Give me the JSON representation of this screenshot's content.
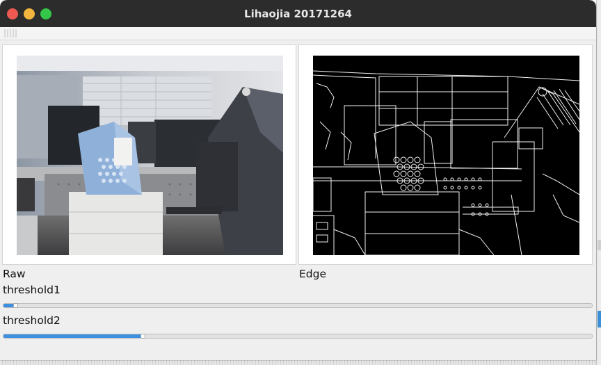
{
  "window": {
    "title": "Lihaojia 20171264"
  },
  "panels": {
    "raw": {
      "label": "Raw"
    },
    "edge": {
      "label": "Edge"
    }
  },
  "sliders": [
    {
      "label": "threshold1",
      "value_fraction": 0.02
    },
    {
      "label": "threshold2",
      "value_fraction": 0.236
    }
  ],
  "colors": {
    "titlebar": "#2c2c2c",
    "slider_accent": "#3d8fe0",
    "close": "#ee5a52",
    "minimize": "#f4b53f",
    "maximize": "#34c749"
  }
}
